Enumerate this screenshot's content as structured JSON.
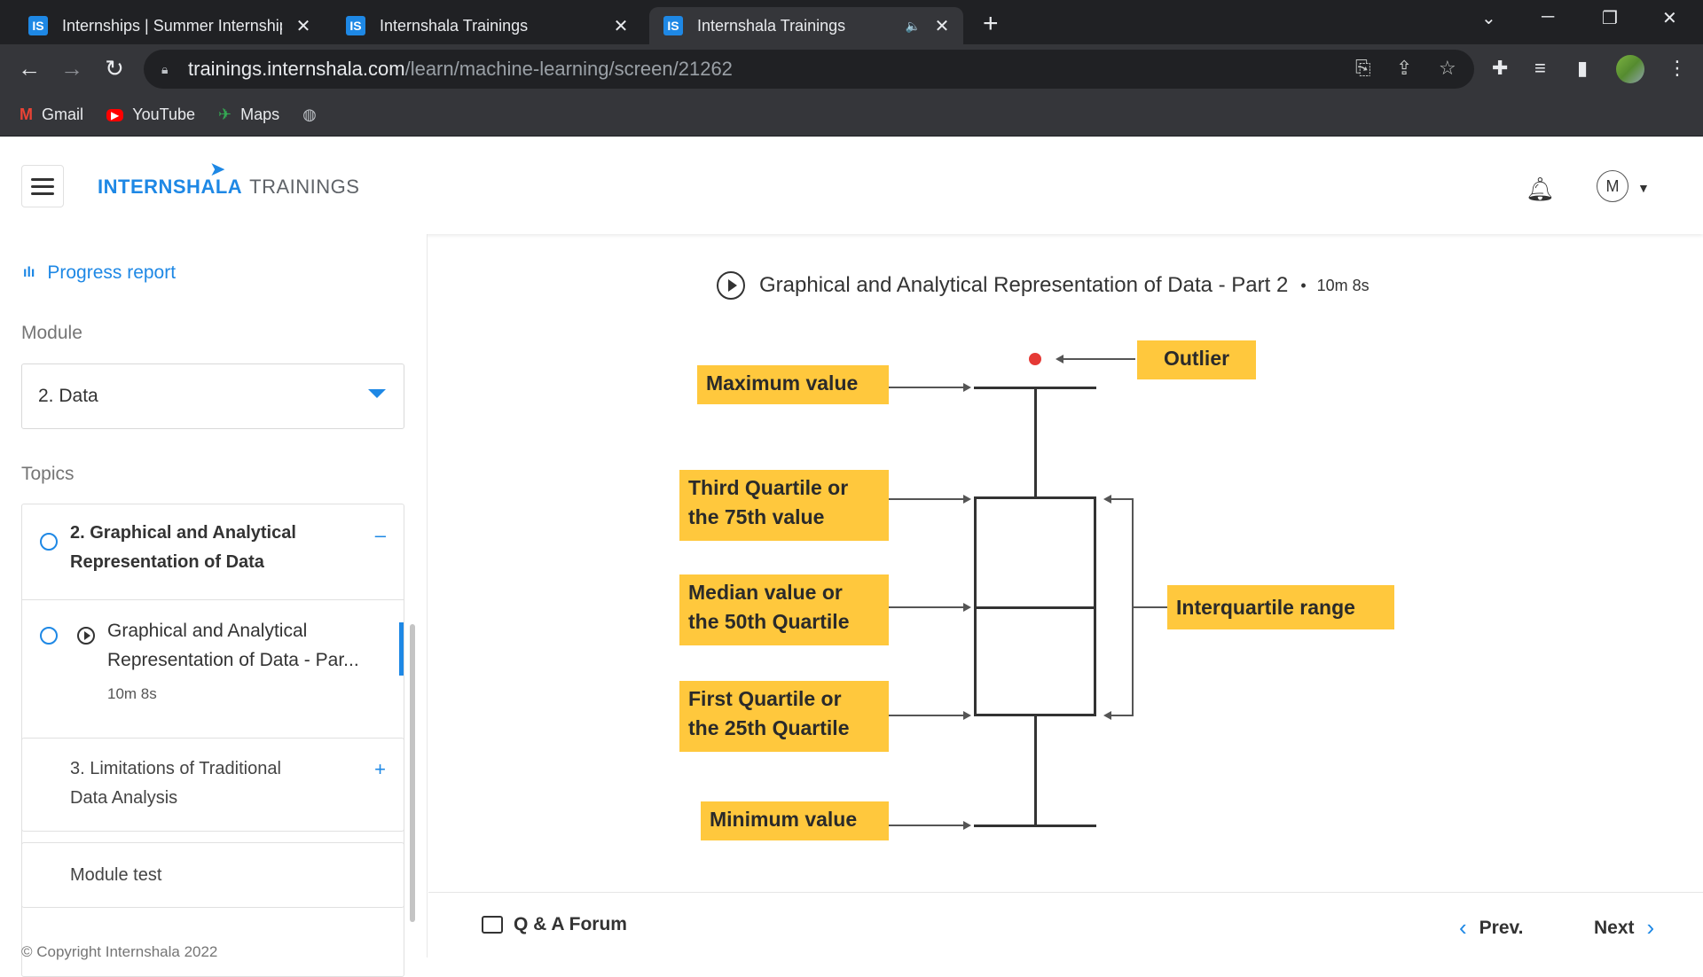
{
  "browser": {
    "tabs": [
      {
        "label": "Internships | Summer Internship",
        "favicon": "IS"
      },
      {
        "label": "Internshala Trainings",
        "favicon": "IS"
      },
      {
        "label": "Internshala Trainings",
        "favicon": "IS",
        "active": true
      }
    ],
    "url_host": "trainings.internshala.com",
    "url_path": "/learn/machine-learning/screen/21262",
    "bookmarks": [
      {
        "label": "Gmail"
      },
      {
        "label": "YouTube"
      },
      {
        "label": "Maps"
      }
    ]
  },
  "header": {
    "logo_primary": "INTERNSHALA",
    "logo_secondary": "TRAININGS",
    "user_initial": "M"
  },
  "sidebar": {
    "progress_label": "Progress report",
    "module_heading": "Module",
    "module_selected": "2. Data",
    "topics_heading": "Topics",
    "topics": [
      {
        "title_line1": "2. Graphical and Analytical",
        "title_line2": "Representation of Data",
        "sign": "–"
      },
      {
        "title_line1": "Graphical and Analytical",
        "title_line2": "Representation of Data - Par...",
        "duration": "10m 8s"
      },
      {
        "title_line1": "3. Limitations of Traditional",
        "title_line2": "Data Analysis",
        "sign": "+"
      },
      {
        "title_line1": "Module test"
      }
    ],
    "copyright": "© Copyright Internshala 2022"
  },
  "lesson": {
    "title": "Graphical and Analytical Representation of Data - Part 2",
    "duration": "10m 8s"
  },
  "diagram": {
    "labels": {
      "outlier": "Outlier",
      "maximum": "Maximum value",
      "q3_line1": "Third Quartile or",
      "q3_line2": "the 75th value",
      "median_line1": "Median value or",
      "median_line2": "the 50th Quartile",
      "q1_line1": "First Quartile or",
      "q1_line2": "the 25th Quartile",
      "minimum": "Minimum value",
      "iqr": "Interquartile range"
    },
    "colors": {
      "label_bg": "#ffc83d",
      "outlier": "#e53935"
    }
  },
  "footer": {
    "qa_label": "Q & A Forum",
    "prev_label": "Prev.",
    "next_label": "Next"
  }
}
